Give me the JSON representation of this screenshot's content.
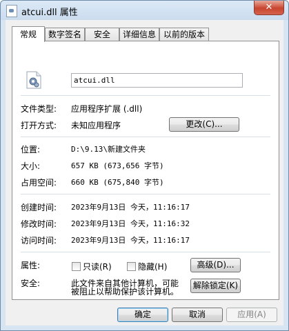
{
  "window": {
    "title": "atcui.dll 属性",
    "close_glyph": "✕"
  },
  "tabs": [
    {
      "label": "常规",
      "active": true
    },
    {
      "label": "数字签名",
      "active": false
    },
    {
      "label": "安全",
      "active": false
    },
    {
      "label": "详细信息",
      "active": false
    },
    {
      "label": "以前的版本",
      "active": false
    }
  ],
  "general": {
    "file_name": "atcui.dll",
    "file_type_label": "文件类型:",
    "file_type_value": "应用程序扩展 (.dll)",
    "opens_with_label": "打开方式:",
    "opens_with_value": "未知应用程序",
    "change_button": "更改(C)...",
    "location_label": "位置:",
    "location_value": "D:\\9.13\\新建文件夹",
    "size_label": "大小:",
    "size_value": "657 KB (673,656 字节)",
    "size_on_disk_label": "占用空间:",
    "size_on_disk_value": "660 KB (675,840 字节)",
    "created_label": "创建时间:",
    "created_value": "2023年9月13日 今天，11:16:17",
    "modified_label": "修改时间:",
    "modified_value": "2023年9月13日 今天，11:16:32",
    "accessed_label": "访问时间:",
    "accessed_value": "2023年9月13日 今天，11:16:17",
    "attributes_label": "属性:",
    "readonly_label": "只读(R)",
    "readonly_checked": false,
    "hidden_label": "隐藏(H)",
    "hidden_checked": false,
    "advanced_button": "高级(D)...",
    "security_label": "安全:",
    "security_text_line1": "此文件来自其他计算机，可能",
    "security_text_line2": "被阻止以帮助保护该计算机。",
    "unblock_button": "解除锁定(K)"
  },
  "footer": {
    "ok": "确定",
    "cancel": "取消",
    "apply": "应用(A)"
  }
}
